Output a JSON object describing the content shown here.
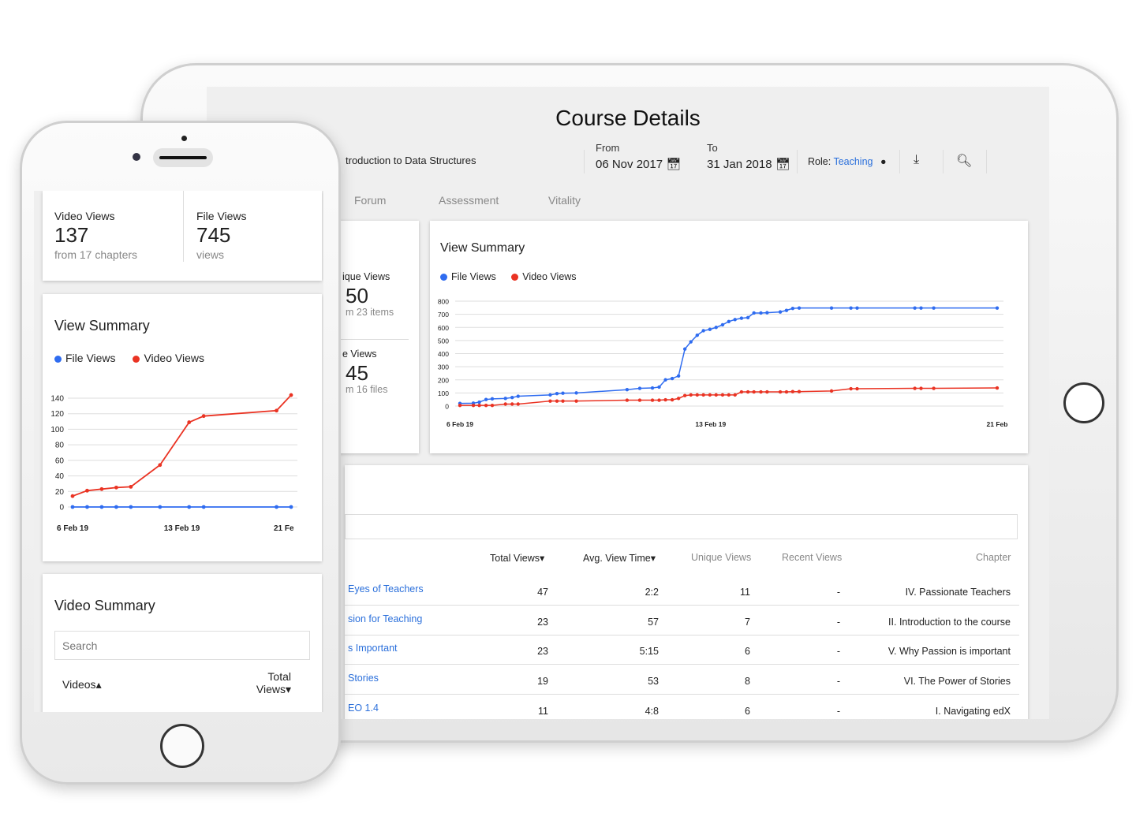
{
  "tablet": {
    "title": "Course Details",
    "course": "troduction to Data Structures",
    "from_label": "From",
    "from_value": "06 Nov 2017",
    "to_label": "To",
    "to_value": "31 Jan 2018",
    "role_label": "Role:",
    "role_value": "Teaching",
    "tabs": [
      "Forum",
      "Assessment",
      "Vitality"
    ],
    "stats": [
      {
        "label": "ique Views",
        "value": "50",
        "sub": "m 23 items"
      },
      {
        "label": "e Views",
        "value": "45",
        "sub": "m 16 files"
      }
    ],
    "view_summary_title": "View Summary",
    "legend": [
      "File Views",
      "Video Views"
    ],
    "table": {
      "headers": [
        "Total Views",
        "Avg. View Time",
        "Unique Views",
        "Recent Views",
        "Chapter"
      ],
      "rows": [
        {
          "name": "Eyes of Teachers",
          "total": "47",
          "avg": "2:2",
          "unique": "11",
          "recent": "-",
          "chapter": "IV. Passionate Teachers"
        },
        {
          "name": "sion for Teaching",
          "total": "23",
          "avg": "57",
          "unique": "7",
          "recent": "-",
          "chapter": "II. Introduction to the course"
        },
        {
          "name": "s Important",
          "total": "23",
          "avg": "5:15",
          "unique": "6",
          "recent": "-",
          "chapter": "V. Why Passion is important"
        },
        {
          "name": "Stories",
          "total": "19",
          "avg": "53",
          "unique": "8",
          "recent": "-",
          "chapter": "VI. The Power of Stories"
        },
        {
          "name": "EO 1.4",
          "total": "11",
          "avg": "4:8",
          "unique": "6",
          "recent": "-",
          "chapter": "I. Navigating edX"
        }
      ]
    }
  },
  "phone": {
    "stats": [
      {
        "label": "Video Views",
        "value": "137",
        "sub": "from 17 chapters"
      },
      {
        "label": "File Views",
        "value": "745",
        "sub": "views"
      }
    ],
    "view_summary_title": "View Summary",
    "legend": [
      "File Views",
      "Video Views"
    ],
    "video_summary_title": "Video Summary",
    "search_placeholder": "Search",
    "col_videos": "Videos",
    "col_total": "Total",
    "col_views": "Views"
  },
  "colors": {
    "file_views": "#2f6cf0",
    "video_views": "#ea3323",
    "link": "#2a6fdb"
  },
  "chart_data": [
    {
      "type": "line",
      "title": "View Summary",
      "ylim": [
        0,
        800
      ],
      "yticks": [
        0,
        100,
        200,
        300,
        400,
        500,
        600,
        700,
        800
      ],
      "xticks": [
        {
          "x": "2019-02-06T00:00",
          "label": "6 Feb 19"
        },
        {
          "x": "2019-02-13T00:00",
          "label": "13 Feb 19"
        },
        {
          "x": "2019-02-21T00:00",
          "label": "21 Feb"
        }
      ],
      "xrange": [
        "2019-02-06T00:00",
        "2019-02-21T00:00"
      ],
      "grid": true,
      "legend": "top-left",
      "x": [
        "2019-02-06T00:00",
        "2019-02-06T09:00",
        "2019-02-06T13:00",
        "2019-02-06T17:30",
        "2019-02-06T21:40",
        "2019-02-07T06:30",
        "2019-02-07T11:00",
        "2019-02-07T15:00",
        "2019-02-08T12:30",
        "2019-02-08T17:00",
        "2019-02-08T21:00",
        "2019-02-09T06:00",
        "2019-02-10T16:00",
        "2019-02-11T00:30",
        "2019-02-11T09:00",
        "2019-02-11T13:30",
        "2019-02-11T17:45",
        "2019-02-11T22:15",
        "2019-02-12T02:30",
        "2019-02-12T06:45",
        "2019-02-12T10:45",
        "2019-02-12T15:00",
        "2019-02-12T19:10",
        "2019-02-12T23:30",
        "2019-02-13T03:40",
        "2019-02-13T08:00",
        "2019-02-13T12:10",
        "2019-02-13T16:20",
        "2019-02-13T20:40",
        "2019-02-14T01:00",
        "2019-02-14T05:00",
        "2019-02-14T09:40",
        "2019-02-14T13:50",
        "2019-02-14T22:40",
        "2019-02-15T02:50",
        "2019-02-15T07:00",
        "2019-02-15T11:20",
        "2019-02-16T09:00",
        "2019-02-16T22:00",
        "2019-02-17T02:10",
        "2019-02-18T16:50",
        "2019-02-18T21:00",
        "2019-02-19T05:30",
        "2019-02-21T00:00"
      ],
      "series": [
        {
          "name": "File Views",
          "color": "#2f6cf0",
          "values": [
            20,
            22,
            30,
            50,
            55,
            58,
            65,
            75,
            85,
            95,
            98,
            100,
            125,
            135,
            138,
            145,
            200,
            210,
            230,
            435,
            490,
            540,
            575,
            585,
            600,
            620,
            645,
            660,
            670,
            675,
            710,
            710,
            712,
            718,
            730,
            745,
            748,
            748,
            748,
            748,
            748,
            748,
            748,
            748
          ]
        },
        {
          "name": "Video Views",
          "color": "#ea3323",
          "values": [
            5,
            5,
            5,
            5,
            5,
            15,
            15,
            15,
            38,
            38,
            38,
            38,
            45,
            45,
            45,
            45,
            48,
            48,
            58,
            80,
            85,
            85,
            85,
            85,
            85,
            85,
            85,
            85,
            108,
            108,
            108,
            108,
            108,
            108,
            108,
            110,
            110,
            115,
            132,
            132,
            135,
            135,
            135,
            138
          ]
        }
      ]
    },
    {
      "type": "line",
      "title": "View Summary",
      "ylim": [
        0,
        140
      ],
      "yticks": [
        0,
        20,
        40,
        60,
        80,
        100,
        120,
        140
      ],
      "xticks": [
        {
          "x": "2019-02-06T00:00",
          "label": "6 Feb 19"
        },
        {
          "x": "2019-02-13T12:00",
          "label": "13 Feb 19"
        },
        {
          "x": "2019-02-20T12:00",
          "label": "21 Fe"
        }
      ],
      "xrange": [
        "2019-02-06T00:00",
        "2019-02-21T00:00"
      ],
      "grid": true,
      "legend": "top-left",
      "x": [
        "2019-02-06T00:00",
        "2019-02-07T00:00",
        "2019-02-08T00:00",
        "2019-02-09T00:00",
        "2019-02-10T00:00",
        "2019-02-12T00:00",
        "2019-02-14T00:00",
        "2019-02-15T00:00",
        "2019-02-20T00:00",
        "2019-02-21T00:00"
      ],
      "series": [
        {
          "name": "File Views",
          "color": "#2f6cf0",
          "values": [
            0,
            0,
            0,
            0,
            0,
            0,
            0,
            0,
            0,
            0
          ]
        },
        {
          "name": "Video Views",
          "color": "#ea3323",
          "values": [
            14,
            21,
            23,
            25,
            26,
            54,
            109,
            117,
            124,
            144
          ]
        }
      ]
    }
  ]
}
